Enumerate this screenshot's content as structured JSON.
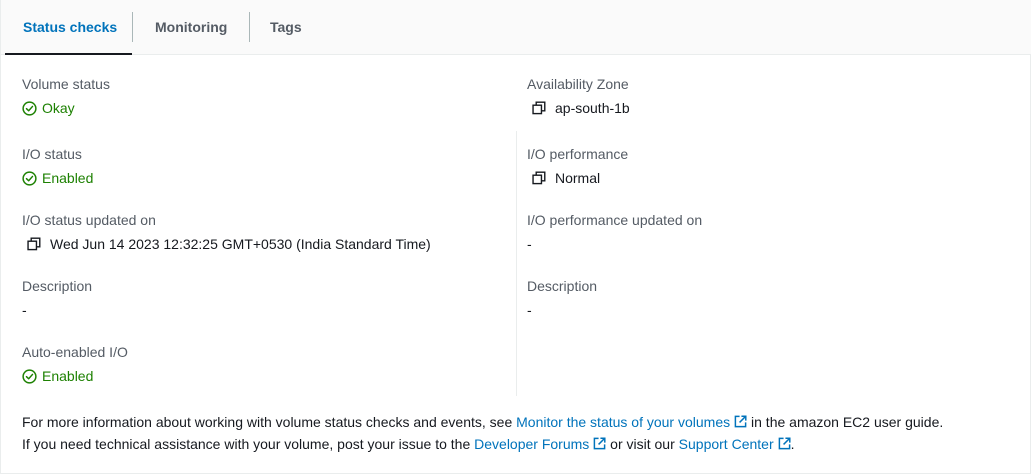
{
  "tabs": [
    {
      "label": "Status checks",
      "active": true
    },
    {
      "label": "Monitoring",
      "active": false
    },
    {
      "label": "Tags",
      "active": false
    }
  ],
  "left": {
    "volume_status": {
      "label": "Volume status",
      "value": "Okay",
      "status": "success"
    },
    "io_status": {
      "label": "I/O status",
      "value": "Enabled",
      "status": "success"
    },
    "io_status_updated": {
      "label": "I/O status updated on",
      "value": "Wed Jun 14 2023 12:32:25 GMT+0530 (India Standard Time)"
    },
    "description": {
      "label": "Description",
      "value": "-"
    },
    "auto_enabled_io": {
      "label": "Auto-enabled I/O",
      "value": "Enabled",
      "status": "success"
    }
  },
  "right": {
    "availability_zone": {
      "label": "Availability Zone",
      "value": "ap-south-1b"
    },
    "io_performance": {
      "label": "I/O performance",
      "value": "Normal"
    },
    "io_performance_updated": {
      "label": "I/O performance updated on",
      "value": "-"
    },
    "description": {
      "label": "Description",
      "value": "-"
    }
  },
  "footer": {
    "line1_prefix": "For more information about working with volume status checks and events, see ",
    "line1_link": "Monitor the status of your volumes",
    "line1_suffix": " in the amazon EC2 user guide.",
    "line2_prefix": "If you need technical assistance with your volume, post your issue to the ",
    "line2_link1": "Developer Forums",
    "line2_middle": " or visit our ",
    "line2_link2": "Support Center",
    "line2_suffix": "."
  },
  "colors": {
    "accent": "#0073bb",
    "success": "#1d8102",
    "text": "#16191f",
    "label": "#545b64"
  },
  "icons": {
    "status_ok": "status-positive-icon",
    "copy": "copy-icon",
    "external": "external-link-icon"
  }
}
